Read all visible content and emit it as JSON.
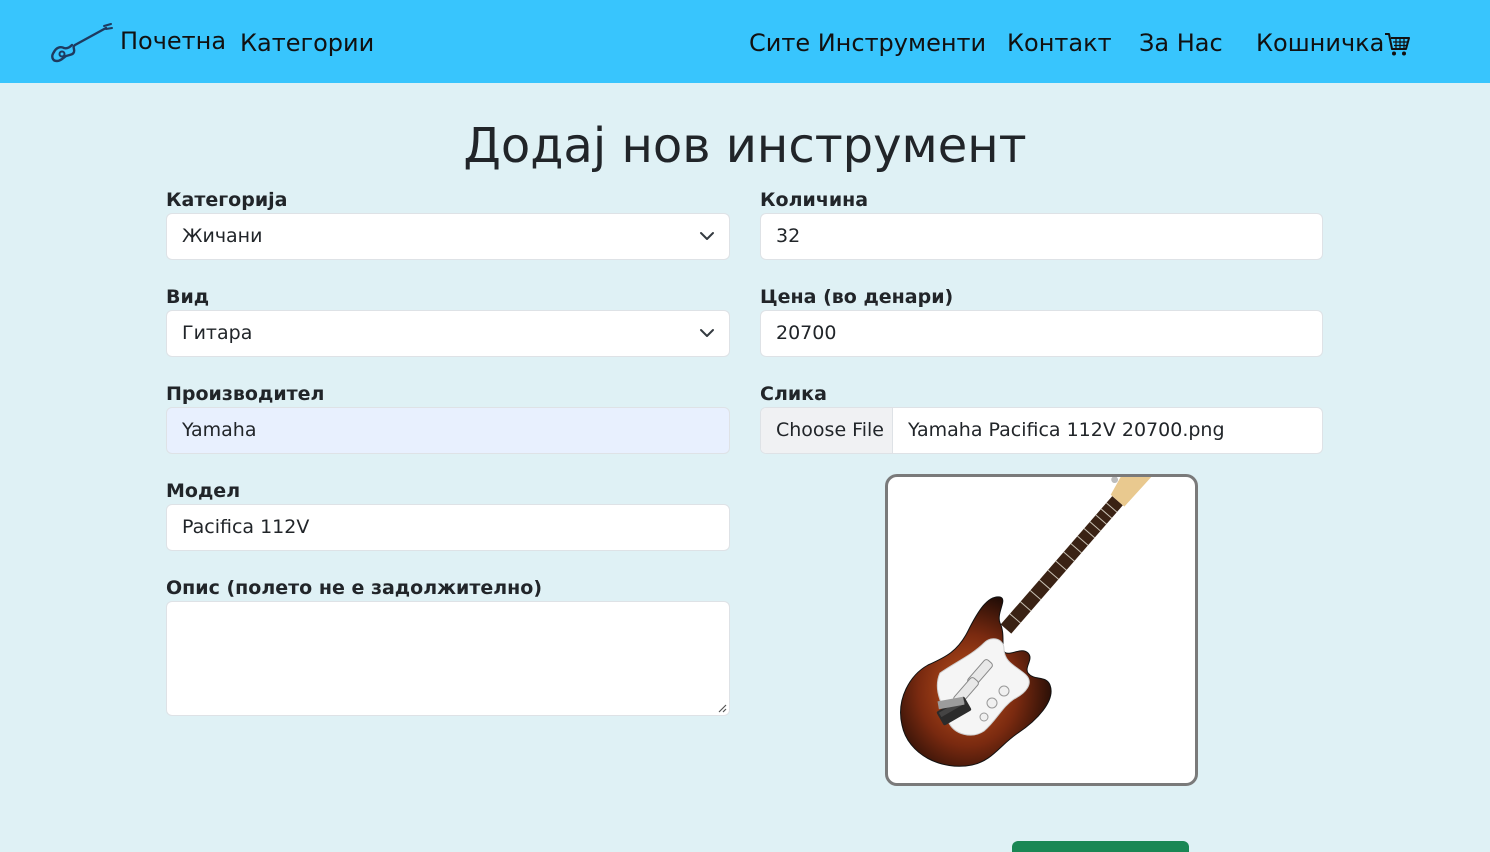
{
  "nav": {
    "home_label": "Почетна",
    "categories_label": "Категории",
    "all_instruments_label": "Сите Инструменти",
    "contact_label": "Контакт",
    "about_label": "За Нас",
    "cart_label": "Кошничка",
    "logo_icon": "guitar-icon",
    "cart_icon": "cart-icon",
    "background_color": "#38c5fd"
  },
  "page": {
    "title": "Додај нов инструмент",
    "background_color": "#dff1f5"
  },
  "form": {
    "category": {
      "label": "Категорија",
      "value": "Жичани"
    },
    "type": {
      "label": "Вид",
      "value": "Гитара"
    },
    "manufacturer": {
      "label": "Производител",
      "value": "Yamaha"
    },
    "model": {
      "label": "Модел",
      "value": "Pacifica 112V"
    },
    "description": {
      "label": "Опис (полето не е задолжително)",
      "value": ""
    },
    "quantity": {
      "label": "Количина",
      "value": "32"
    },
    "price": {
      "label": "Цена (во денари)",
      "value": "20700"
    },
    "image": {
      "label": "Слика",
      "button_label": "Choose File",
      "file_name": "Yamaha Pacifica 112V 20700.png"
    },
    "submit_button_color": "#198754"
  }
}
